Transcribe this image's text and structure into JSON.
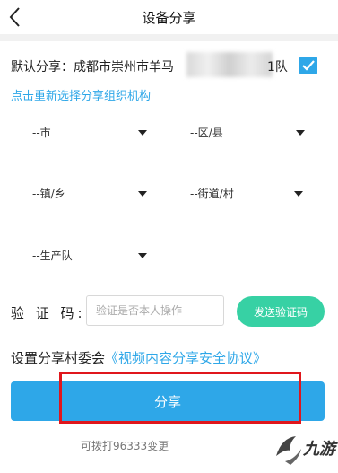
{
  "header": {
    "title": "设备分享",
    "back_icon": "chevron-left-icon"
  },
  "default_share": {
    "label": "默认分享：成都市崇州市羊马",
    "suffix": "1队",
    "checked": true,
    "check_color": "#2ea7e8"
  },
  "reselect_link": "点击重新选择分享组织机构",
  "selects": {
    "city": "--市",
    "district": "--区/县",
    "town": "--镇/乡",
    "street": "--街道/村",
    "team": "--生产队"
  },
  "verification": {
    "label": "验 证 码:",
    "placeholder": "验证是否本人操作",
    "send_button": "发送验证码"
  },
  "share_section": {
    "title": "设置分享村委会",
    "agreement": "《视频内容分享安全协议》"
  },
  "share_button": "分享",
  "footer_note": "可拨打96333变更",
  "watermark": {
    "text": "九游",
    "logo_icon": "jiuyou-logo-icon"
  },
  "colors": {
    "accent": "#2ea7e8",
    "send_button": "#37d1a4",
    "highlight": "#e0161c"
  }
}
